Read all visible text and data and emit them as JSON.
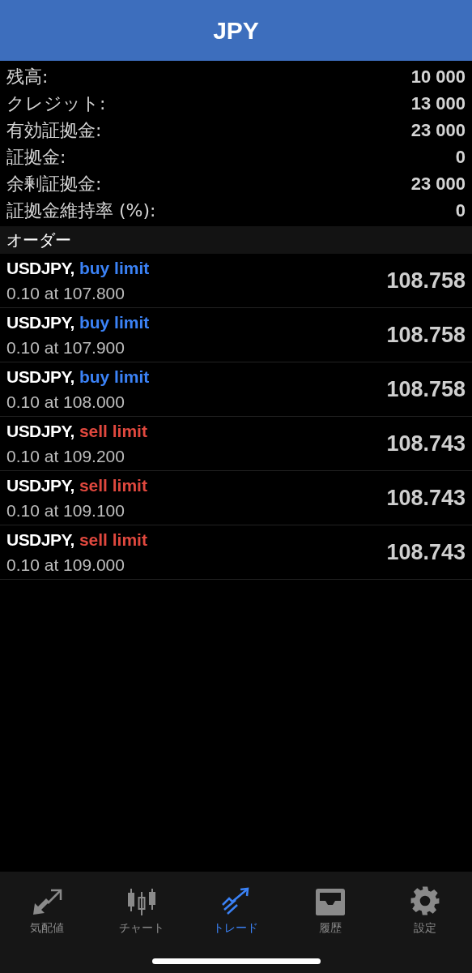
{
  "header": {
    "title": "JPY"
  },
  "summary": [
    {
      "label": "残高:",
      "value": "10 000"
    },
    {
      "label": "クレジット:",
      "value": "13 000"
    },
    {
      "label": "有効証拠金:",
      "value": "23 000"
    },
    {
      "label": "証拠金:",
      "value": "0"
    },
    {
      "label": "余剰証拠金:",
      "value": "23 000"
    },
    {
      "label": "証拠金維持率 (%):",
      "value": "0"
    }
  ],
  "orders_section": {
    "title": "オーダー"
  },
  "orders": [
    {
      "symbol": "USDJPY,",
      "type": "buy limit",
      "kind": "buy",
      "detail": "0.10 at 107.800",
      "price": "108.758"
    },
    {
      "symbol": "USDJPY,",
      "type": "buy limit",
      "kind": "buy",
      "detail": "0.10 at 107.900",
      "price": "108.758"
    },
    {
      "symbol": "USDJPY,",
      "type": "buy limit",
      "kind": "buy",
      "detail": "0.10 at 108.000",
      "price": "108.758"
    },
    {
      "symbol": "USDJPY,",
      "type": "sell limit",
      "kind": "sell",
      "detail": "0.10 at 109.200",
      "price": "108.743"
    },
    {
      "symbol": "USDJPY,",
      "type": "sell limit",
      "kind": "sell",
      "detail": "0.10 at 109.100",
      "price": "108.743"
    },
    {
      "symbol": "USDJPY,",
      "type": "sell limit",
      "kind": "sell",
      "detail": "0.10 at 109.000",
      "price": "108.743"
    }
  ],
  "tab_bar": [
    {
      "label": "気配値",
      "kind": "quotes",
      "selected": false
    },
    {
      "label": "チャート",
      "kind": "chart",
      "selected": false
    },
    {
      "label": "トレード",
      "kind": "trade",
      "selected": true
    },
    {
      "label": "履歴",
      "kind": "history",
      "selected": false
    },
    {
      "label": "設定",
      "kind": "settings",
      "selected": false
    }
  ]
}
